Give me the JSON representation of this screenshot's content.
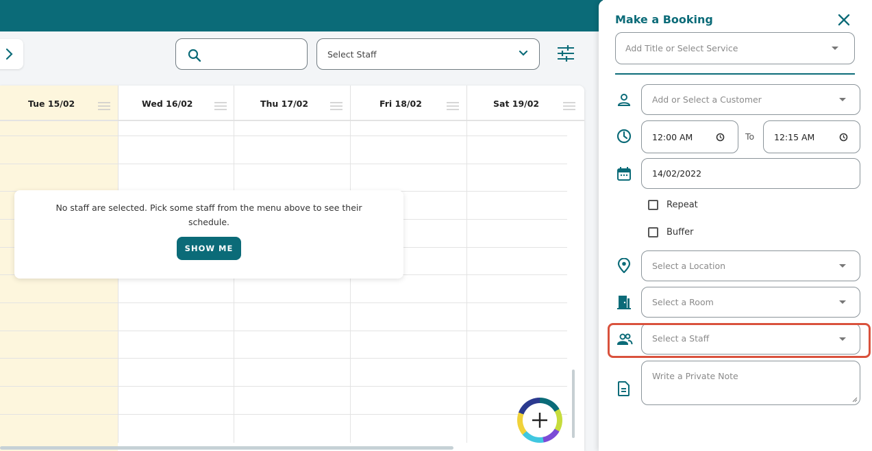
{
  "colors": {
    "brand": "#0b6b78",
    "today_bg": "#fdf6dd",
    "highlight": "#d9513c"
  },
  "toolbar": {
    "search_placeholder": "",
    "staff_select_label": "Select Staff"
  },
  "calendar": {
    "days": [
      {
        "label": "Tue 15/02",
        "today": true
      },
      {
        "label": "Wed 16/02",
        "today": false
      },
      {
        "label": "Thu 17/02",
        "today": false
      },
      {
        "label": "Fri 18/02",
        "today": false
      },
      {
        "label": "Sat 19/02",
        "today": false
      }
    ],
    "notice_text": "No staff are selected. Pick some staff from the menu above to see their schedule.",
    "show_me_label": "SHOW ME"
  },
  "booking_panel": {
    "title": "Make a Booking",
    "title_select_placeholder": "Add Title or Select Service",
    "customer_placeholder": "Add or Select a Customer",
    "start_time": "12:00 AM",
    "to_label": "To",
    "end_time": "12:15 AM",
    "date": "14/02/2022",
    "repeat_label": "Repeat",
    "buffer_label": "Buffer",
    "location_placeholder": "Select a Location",
    "room_placeholder": "Select a Room",
    "staff_placeholder": "Select a Staff",
    "note_placeholder": "Write a Private Note"
  }
}
